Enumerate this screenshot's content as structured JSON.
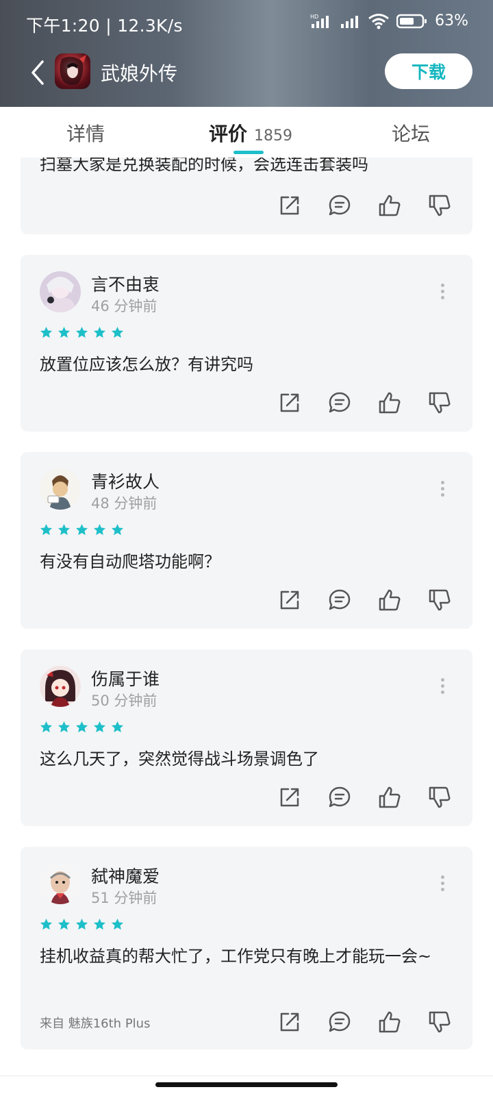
{
  "status_bar": {
    "time": "下午1:20",
    "speed": "12.3K/s",
    "hd_label": "HD",
    "battery": "63%"
  },
  "header": {
    "app_title": "武娘外传",
    "download_label": "下载",
    "accent_color": "#16b7c0"
  },
  "tabs": {
    "details": "详情",
    "reviews": "评价",
    "reviews_count": "1859",
    "forum": "论坛"
  },
  "reviews": [
    {
      "partial": true,
      "text": "扫墓大家是兑换装配的时候，会选连击套装吗"
    },
    {
      "username": "言不由衷",
      "time": "46 分钟前",
      "rating": 5,
      "text": "放置位应该怎么放？有讲究吗"
    },
    {
      "username": "青衫故人",
      "time": "48 分钟前",
      "rating": 5,
      "text": "有没有自动爬塔功能啊？"
    },
    {
      "username": "伤属于谁",
      "time": "50 分钟前",
      "rating": 5,
      "text": "这么几天了，突然觉得战斗场景调色了"
    },
    {
      "username": "弑神魔爱",
      "time": "51 分钟前",
      "rating": 5,
      "text": "挂机收益真的帮大忙了，工作党只有晚上才能玩一会~",
      "device": "来自 魅族16th Plus"
    }
  ],
  "icons": {
    "action_order": [
      "share-icon",
      "comment-icon",
      "thumbs-up-icon",
      "thumbs-down-icon"
    ]
  },
  "colors": {
    "star": "#1dbfc8",
    "card_bg": "#f4f5f7"
  }
}
